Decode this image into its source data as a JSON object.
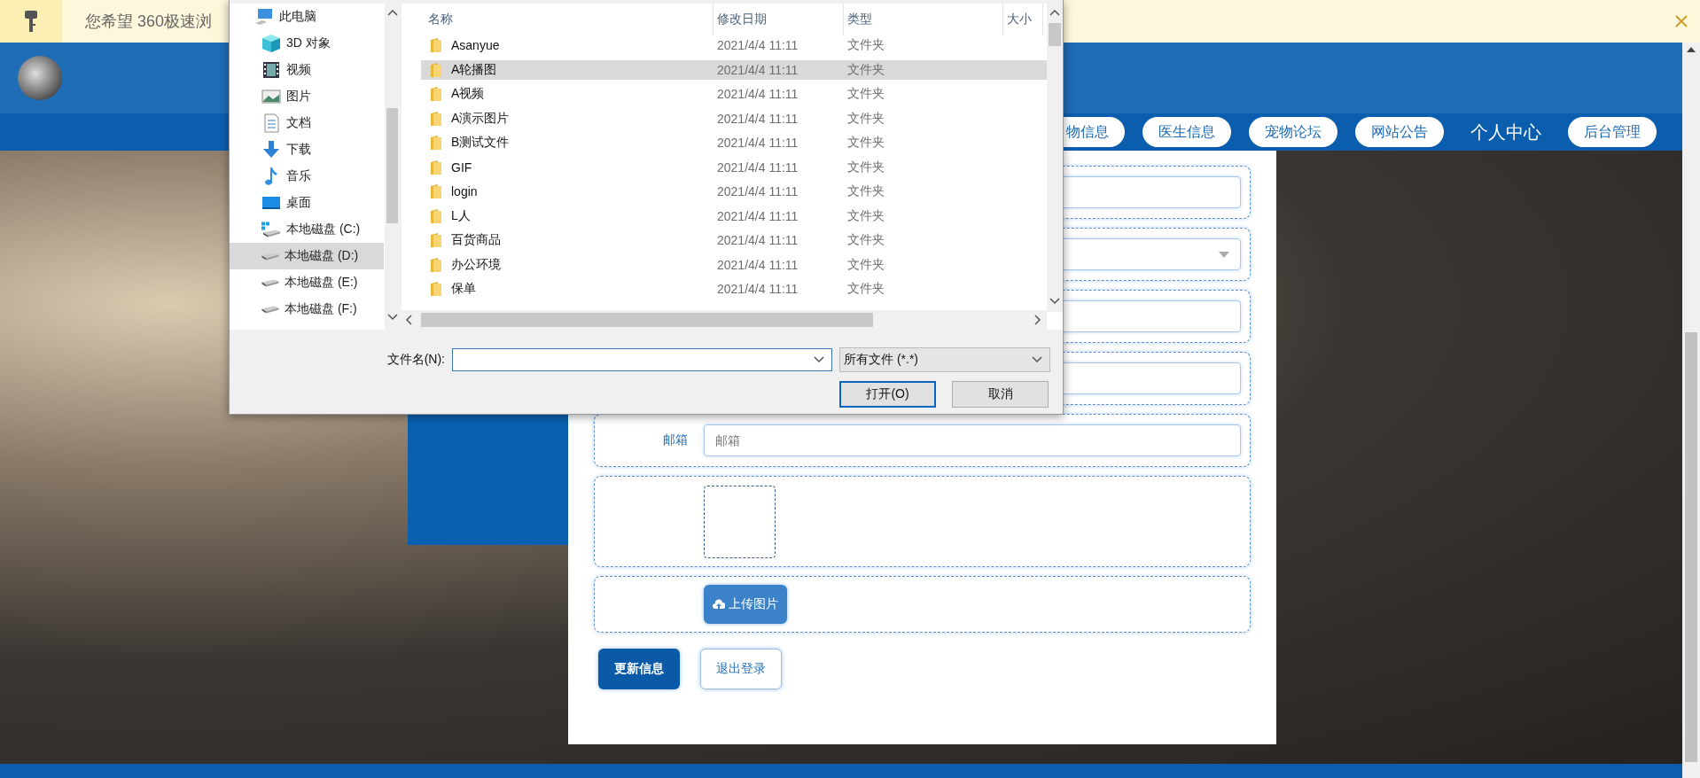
{
  "notification": {
    "text": "您希望 360极速浏"
  },
  "nav": {
    "items": [
      {
        "label": "物信息",
        "selected": false
      },
      {
        "label": "医生信息",
        "selected": false
      },
      {
        "label": "宠物论坛",
        "selected": false
      },
      {
        "label": "网站公告",
        "selected": false
      },
      {
        "label": "个人中心",
        "selected": true
      },
      {
        "label": "后台管理",
        "selected": false
      }
    ]
  },
  "form": {
    "rows": [
      {
        "kind": "input"
      },
      {
        "kind": "select"
      },
      {
        "kind": "input"
      },
      {
        "kind": "input"
      },
      {
        "kind": "input",
        "label": "邮箱",
        "placeholder": "邮箱"
      },
      {
        "kind": "image"
      },
      {
        "kind": "upload",
        "button": "上传图片"
      }
    ],
    "buttons": [
      {
        "label": "更新信息",
        "kind": "primary"
      },
      {
        "label": "退出登录",
        "kind": "secondary"
      }
    ]
  },
  "dialog": {
    "nav": [
      {
        "label": "此电脑",
        "kind": "pc",
        "selected": false,
        "children": [
          {
            "label": "3D 对象",
            "kind": "cube",
            "selected": false
          },
          {
            "label": "视频",
            "kind": "video",
            "selected": false
          },
          {
            "label": "图片",
            "kind": "picture",
            "selected": false
          },
          {
            "label": "文档",
            "kind": "document",
            "selected": false
          },
          {
            "label": "下载",
            "kind": "download",
            "selected": false
          },
          {
            "label": "音乐",
            "kind": "music",
            "selected": false
          },
          {
            "label": "桌面",
            "kind": "desktop",
            "selected": false
          },
          {
            "label": "本地磁盘 (C:)",
            "kind": "system-drive",
            "selected": false
          },
          {
            "label": "本地磁盘 (D:)",
            "kind": "drive",
            "selected": true
          },
          {
            "label": "本地磁盘 (E:)",
            "kind": "drive",
            "selected": false
          },
          {
            "label": "本地磁盘 (F:)",
            "kind": "drive",
            "selected": false
          }
        ]
      }
    ],
    "columns": [
      "名称",
      "修改日期",
      "类型",
      "大小"
    ],
    "files": [
      {
        "name": "Asanyue",
        "modified": "2021/4/4 11:11",
        "type": "文件夹",
        "selected": false
      },
      {
        "name": "A轮播图",
        "modified": "2021/4/4 11:11",
        "type": "文件夹",
        "selected": true
      },
      {
        "name": "A视频",
        "modified": "2021/4/4 11:11",
        "type": "文件夹",
        "selected": false
      },
      {
        "name": "A演示图片",
        "modified": "2021/4/4 11:11",
        "type": "文件夹",
        "selected": false
      },
      {
        "name": "B测试文件",
        "modified": "2021/4/4 11:11",
        "type": "文件夹",
        "selected": false
      },
      {
        "name": "GIF",
        "modified": "2021/4/4 11:11",
        "type": "文件夹",
        "selected": false
      },
      {
        "name": "login",
        "modified": "2021/4/4 11:11",
        "type": "文件夹",
        "selected": false
      },
      {
        "name": "L人",
        "modified": "2021/4/4 11:11",
        "type": "文件夹",
        "selected": false
      },
      {
        "name": "百货商品",
        "modified": "2021/4/4 11:11",
        "type": "文件夹",
        "selected": false
      },
      {
        "name": "办公环境",
        "modified": "2021/4/4 11:11",
        "type": "文件夹",
        "selected": false
      },
      {
        "name": "保单",
        "modified": "2021/4/4 11:11",
        "type": "文件夹",
        "selected": false
      }
    ],
    "filename_label": "文件名(N):",
    "filter": "所有文件 (*.*)",
    "buttons": [
      {
        "label": "打开(O)",
        "kind": "default"
      },
      {
        "label": "取消",
        "kind": "normal"
      }
    ]
  }
}
